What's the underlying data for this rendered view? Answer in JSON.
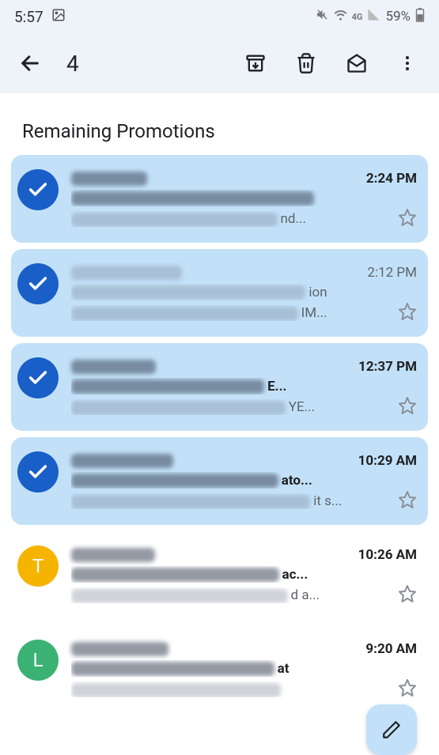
{
  "status": {
    "time": "5:57",
    "battery": "59%",
    "network": "4G"
  },
  "toolbar": {
    "count": "4"
  },
  "section": {
    "title": "Remaining Promotions"
  },
  "emails": [
    {
      "selected": true,
      "unread": true,
      "time": "2:24 PM",
      "subject_tail": "",
      "snippet_tail": "nd..."
    },
    {
      "selected": true,
      "unread": false,
      "time": "2:12 PM",
      "subject_tail": "ion",
      "snippet_tail": "IM..."
    },
    {
      "selected": true,
      "unread": true,
      "time": "12:37 PM",
      "subject_tail": "E...",
      "snippet_tail": "YE..."
    },
    {
      "selected": true,
      "unread": true,
      "time": "10:29 AM",
      "subject_tail": "ato...",
      "snippet_tail": "it s..."
    },
    {
      "selected": false,
      "avatar_letter": "T",
      "avatar_color": "#f5b400",
      "unread": true,
      "time": "10:26 AM",
      "subject_tail": "ac...",
      "snippet_tail": "d a..."
    },
    {
      "selected": false,
      "avatar_letter": "L",
      "avatar_color": "#3bb273",
      "unread": true,
      "time": "9:20 AM",
      "subject_tail": "at",
      "snippet_tail": ""
    }
  ]
}
